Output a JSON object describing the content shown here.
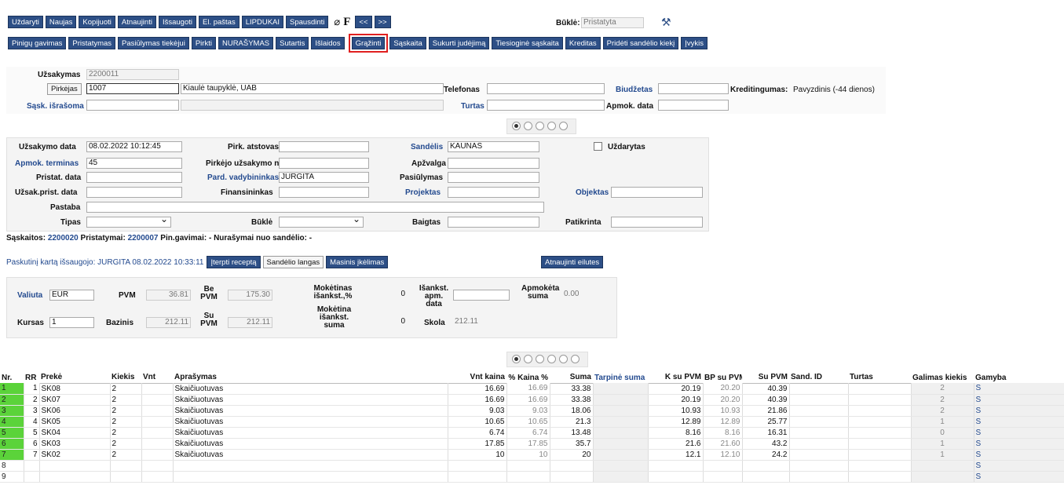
{
  "toolbar1": {
    "buttons": [
      "Uždaryti",
      "Naujas",
      "Kopijuoti",
      "Atnaujinti",
      "Išsaugoti",
      "El. paštas",
      "LIPDUKAI",
      "Spausdinti",
      "<<",
      ">>"
    ],
    "f_label": "F",
    "bukle_label": "Būklė:",
    "bukle_value": "Pristatyta"
  },
  "toolbar2": {
    "buttons": [
      "Pinigų gavimas",
      "Pristatymas",
      "Pasiūlymas tiekėjui",
      "Pirkti",
      "NURAŠYMAS",
      "Sutartis",
      "Išlaidos",
      "Grąžinti",
      "Sąskaita",
      "Sukurti judėjimą",
      "Tiesioginė sąskaita",
      "Kreditas",
      "Pridėti sandėlio kiekį",
      "Įvykis"
    ]
  },
  "header": {
    "uzsakymas_label": "Užsakymas",
    "uzsakymas_value": "2200011",
    "pirkejas_label": "Pirkėjas",
    "pirkejas_value": "1007",
    "pirkejas_name": "Kiaulė taupyklė, UAB",
    "telefonas_label": "Telefonas",
    "biudzetas_label": "Biudžetas",
    "kreditingumas_label": "Kreditingumas:",
    "kreditingumas_value": "Pavyzdinis (-44 dienos)",
    "sask_label": "Sąsk. išrašoma",
    "turtas_label": "Turtas",
    "apmok_label": "Apmok. data"
  },
  "form": {
    "uzsakymo_data_label": "Užsakymo data",
    "uzsakymo_data_value": "08.02.2022 10:12:45",
    "pirk_atstovas_label": "Pirk. atstovas",
    "sandelis_label": "Sandėlis",
    "sandelis_value": "KAUNAS",
    "uzdarytas_label": "Uždarytas",
    "apmok_terminas_label": "Apmok. terminas",
    "apmok_terminas_value": "45",
    "pirkejo_nr_label": "Pirkėjo užsakymo nr.",
    "apzvalga_label": "Apžvalga",
    "pristat_data_label": "Pristat. data",
    "pard_vadyb_label": "Pard. vadybininkas",
    "pard_vadyb_value": "JURGITA",
    "pasiulymas_label": "Pasiūlymas",
    "uzsak_prist_label": "Užsak.prist. data",
    "finansininkas_label": "Finansininkas",
    "projektas_label": "Projektas",
    "objektas_label": "Objektas",
    "pastaba_label": "Pastaba",
    "tipas_label": "Tipas",
    "bukle_label": "Būklė",
    "baigtas_label": "Baigtas",
    "patikrinta_label": "Patikrinta"
  },
  "links_line": {
    "saskaitos_label": "Sąskaitos:",
    "saskaitos_value": "2200020",
    "pristatymai_label": "Pristatymai:",
    "pristatymai_value": "2200007",
    "rest": "Pin.gavimai: - Nurašymai nuo sandėlio: -"
  },
  "save_line": {
    "text": "Paskutinį kartą išsaugojo: JURGITA 08.02.2022 10:33:11",
    "buttons": [
      "Įterpti receptą",
      "Sandėlio langas",
      "Masinis įkėlimas"
    ],
    "refresh": "Atnaujinti eilutes"
  },
  "totals": {
    "valiuta_label": "Valiuta",
    "valiuta_value": "EUR",
    "pvm_label": "PVM",
    "pvm_value": "36.81",
    "be_pvm_label": "Be PVM",
    "be_pvm_value": "175.30",
    "mok_isankst_label": "Mokėtinas išankst.,%",
    "mok_isankst_value": "0",
    "isankst_data_label": "Išankst. apm. data",
    "apmoketa_label": "Apmokėta suma",
    "apmoketa_value": "0.00",
    "kursas_label": "Kursas",
    "kursas_value": "1",
    "bazinis_label": "Bazinis",
    "bazinis_value": "212.11",
    "su_pvm_label": "Su PVM",
    "su_pvm_value": "212.11",
    "mok_suma_label": "Mokėtina išankst. suma",
    "mok_suma_value": "0",
    "skola_label": "Skola",
    "skola_value": "212.11"
  },
  "table": {
    "headers": [
      "Nr.",
      "RR",
      "Prekė",
      "Kiekis",
      "Vnt",
      "Aprašymas",
      "Vnt kaina",
      "% Kaina %",
      "Suma",
      "Tarpinė suma",
      "K su PVM",
      "BP su PVM",
      "Su PVM",
      "Sand. ID",
      "Turtas",
      "Galimas kiekis",
      "Gamyba"
    ],
    "rows": [
      {
        "nr": "1",
        "rr": "1",
        "preke": "SK08",
        "kiekis": "2",
        "apr": "Skaičiuotuvas",
        "kaina": "16.69",
        "pkaina": "16.69",
        "suma": "33.38",
        "k": "20.19",
        "bp": "20.20",
        "su": "40.39",
        "gal": "2",
        "s": "S"
      },
      {
        "nr": "2",
        "rr": "2",
        "preke": "SK07",
        "kiekis": "2",
        "apr": "Skaičiuotuvas",
        "kaina": "16.69",
        "pkaina": "16.69",
        "suma": "33.38",
        "k": "20.19",
        "bp": "20.20",
        "su": "40.39",
        "gal": "2",
        "s": "S"
      },
      {
        "nr": "3",
        "rr": "3",
        "preke": "SK06",
        "kiekis": "2",
        "apr": "Skaičiuotuvas",
        "kaina": "9.03",
        "pkaina": "9.03",
        "suma": "18.06",
        "k": "10.93",
        "bp": "10.93",
        "su": "21.86",
        "gal": "2",
        "s": "S"
      },
      {
        "nr": "4",
        "rr": "4",
        "preke": "SK05",
        "kiekis": "2",
        "apr": "Skaičiuotuvas",
        "kaina": "10.65",
        "pkaina": "10.65",
        "suma": "21.3",
        "k": "12.89",
        "bp": "12.89",
        "su": "25.77",
        "gal": "1",
        "s": "S"
      },
      {
        "nr": "5",
        "rr": "5",
        "preke": "SK04",
        "kiekis": "2",
        "apr": "Skaičiuotuvas",
        "kaina": "6.74",
        "pkaina": "6.74",
        "suma": "13.48",
        "k": "8.16",
        "bp": "8.16",
        "su": "16.31",
        "gal": "0",
        "s": "S"
      },
      {
        "nr": "6",
        "rr": "6",
        "preke": "SK03",
        "kiekis": "2",
        "apr": "Skaičiuotuvas",
        "kaina": "17.85",
        "pkaina": "17.85",
        "suma": "35.7",
        "k": "21.6",
        "bp": "21.60",
        "su": "43.2",
        "gal": "1",
        "s": "S"
      },
      {
        "nr": "7",
        "rr": "7",
        "preke": "SK02",
        "kiekis": "2",
        "apr": "Skaičiuotuvas",
        "kaina": "10",
        "pkaina": "10",
        "suma": "20",
        "k": "12.1",
        "bp": "12.10",
        "su": "24.2",
        "gal": "1",
        "s": "S"
      },
      {
        "nr": "8",
        "rr": "",
        "preke": "",
        "kiekis": "",
        "apr": "",
        "kaina": "",
        "pkaina": "",
        "suma": "",
        "k": "",
        "bp": "",
        "su": "",
        "gal": "",
        "s": "S"
      },
      {
        "nr": "9",
        "rr": "",
        "preke": "",
        "kiekis": "",
        "apr": "",
        "kaina": "",
        "pkaina": "",
        "suma": "",
        "k": "",
        "bp": "",
        "su": "",
        "gal": "",
        "s": "S"
      }
    ]
  }
}
